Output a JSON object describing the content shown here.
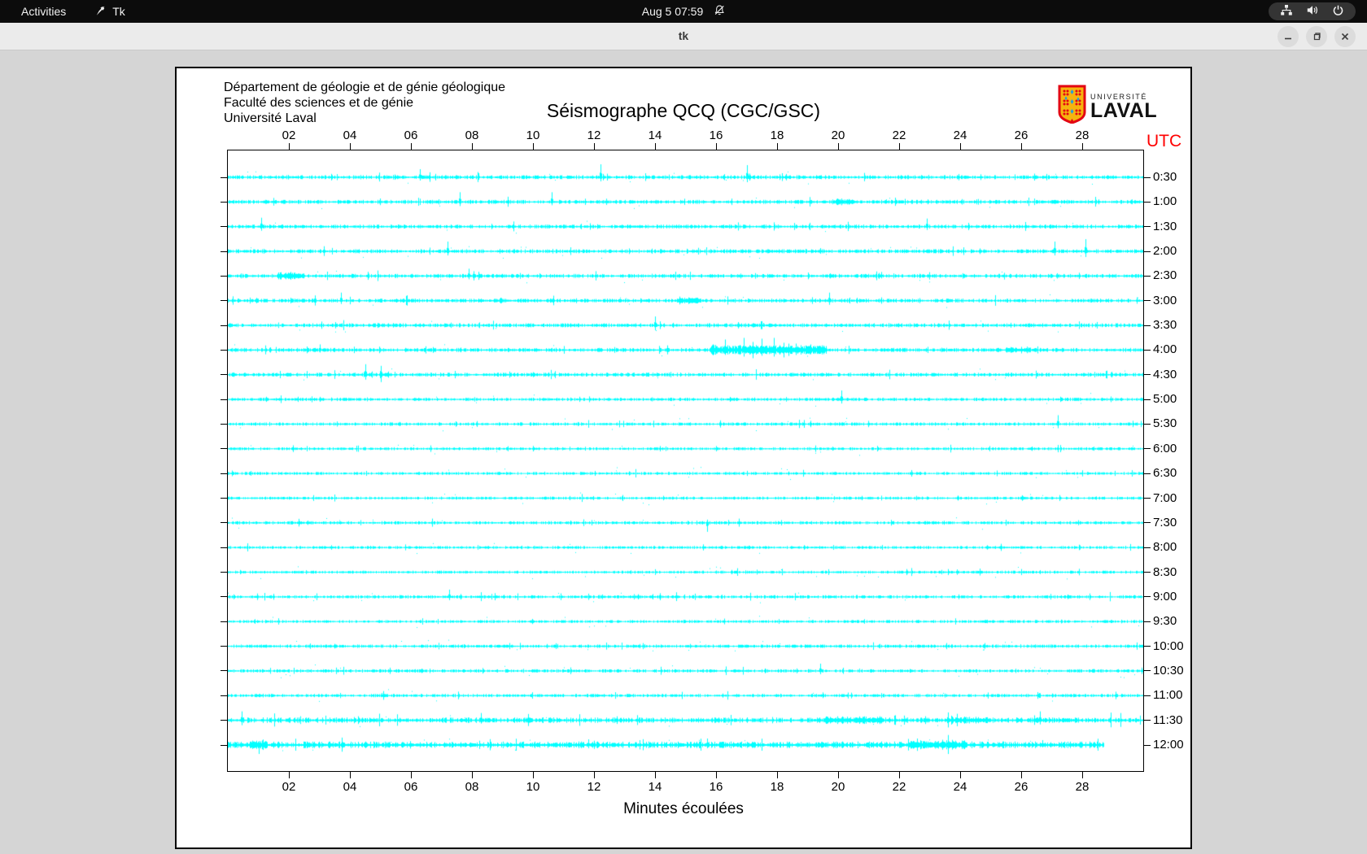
{
  "desktop": {
    "top_bar": {
      "activities_label": "Activities",
      "app_name": "Tk",
      "clock": "Aug 5 07:59",
      "icon_names": [
        "tk-app-icon",
        "notifications-disabled-icon",
        "network-wired-icon",
        "volume-icon",
        "power-icon"
      ]
    },
    "window": {
      "title": "tk",
      "controls": [
        "minimize",
        "maximize",
        "close"
      ]
    }
  },
  "seismograph": {
    "header_lines": [
      "Département de géologie et de génie géologique",
      "Faculté des sciences et de génie",
      "Université Laval"
    ],
    "title": "Séismographe QCQ (CGC/GSC)",
    "utc_label": "UTC",
    "x_axis_label": "Minutes écoulées",
    "logo": {
      "line1": "UNIVERSITÉ",
      "line2": "LAVAL"
    },
    "colors": {
      "trace": "#00ffff",
      "utc_label": "#ff0000",
      "logo_gold": "#f6b40e",
      "logo_red": "#e30513",
      "logo_blue": "#2b9cd8"
    },
    "chart_data": {
      "type": "line",
      "description": "24 half-hour seismogram sweeps, 30 minutes per line",
      "x_range_minutes": [
        0,
        30
      ],
      "x_tick_minutes": [
        2,
        4,
        6,
        8,
        10,
        12,
        14,
        16,
        18,
        20,
        22,
        24,
        26,
        28
      ],
      "x_tick_labels": [
        "02",
        "04",
        "06",
        "08",
        "10",
        "12",
        "14",
        "16",
        "18",
        "20",
        "22",
        "24",
        "26",
        "28"
      ],
      "rows": [
        {
          "label": "0:30",
          "base": 1.2,
          "end": 30,
          "spikes": [
            [
              6.3,
              10,
              4
            ],
            [
              8.2,
              5,
              3
            ],
            [
              12.2,
              16,
              5
            ],
            [
              17.0,
              15,
              6
            ]
          ],
          "bands": []
        },
        {
          "label": "1:00",
          "base": 1.2,
          "end": 30,
          "spikes": [
            [
              7.6,
              12,
              5
            ],
            [
              10.6,
              12,
              4
            ],
            [
              20.1,
              4,
              4
            ]
          ],
          "bands": [
            [
              19.8,
              20.5,
              1.5
            ]
          ]
        },
        {
          "label": "1:30",
          "base": 1.2,
          "end": 30,
          "spikes": [
            [
              1.1,
              11,
              5
            ],
            [
              22.9,
              10,
              4
            ]
          ],
          "bands": []
        },
        {
          "label": "2:00",
          "base": 1.2,
          "end": 30,
          "spikes": [
            [
              7.2,
              12,
              5
            ],
            [
              19.4,
              4,
              3
            ],
            [
              27.1,
              12,
              5
            ],
            [
              28.1,
              15,
              7
            ]
          ],
          "bands": []
        },
        {
          "label": "2:30",
          "base": 1.2,
          "end": 30,
          "spikes": [
            [
              1.9,
              4,
              4
            ],
            [
              2.3,
              3,
              3
            ],
            [
              7.9,
              9,
              4
            ],
            [
              16.8,
              3,
              3
            ],
            [
              21.4,
              5,
              3
            ]
          ],
          "bands": [
            [
              1.6,
              2.5,
              2
            ]
          ]
        },
        {
          "label": "3:00",
          "base": 1.2,
          "end": 30,
          "spikes": [
            [
              3.7,
              10,
              4
            ],
            [
              11.4,
              3,
              3
            ],
            [
              15.1,
              4,
              4
            ],
            [
              19.7,
              10,
              5
            ]
          ],
          "bands": [
            [
              14.8,
              15.4,
              2
            ]
          ]
        },
        {
          "label": "3:30",
          "base": 1.2,
          "end": 30,
          "spikes": [
            [
              4.9,
              3,
              3
            ],
            [
              14.0,
              11,
              6
            ]
          ],
          "bands": []
        },
        {
          "label": "4:00",
          "base": 1.2,
          "end": 30,
          "spikes": [
            [
              3.0,
              7,
              3
            ],
            [
              16.3,
              13,
              6
            ],
            [
              16.9,
              15,
              8
            ],
            [
              17.2,
              10,
              10
            ],
            [
              17.5,
              14,
              7
            ],
            [
              17.9,
              15,
              8
            ],
            [
              18.2,
              9,
              9
            ],
            [
              18.6,
              8,
              6
            ],
            [
              19.1,
              7,
              5
            ],
            [
              26.0,
              4,
              4
            ]
          ],
          "bands": [
            [
              15.8,
              19.6,
              3.5
            ],
            [
              25.5,
              26.3,
              1.5
            ]
          ]
        },
        {
          "label": "4:30",
          "base": 1.2,
          "end": 30,
          "spikes": [
            [
              4.5,
              13,
              6
            ],
            [
              5.0,
              11,
              9
            ]
          ],
          "bands": []
        },
        {
          "label": "5:00",
          "base": 1.0,
          "end": 30,
          "spikes": [
            [
              20.1,
              11,
              5
            ]
          ],
          "bands": []
        },
        {
          "label": "5:30",
          "base": 1.0,
          "end": 30,
          "spikes": [
            [
              27.2,
              11,
              5
            ]
          ],
          "bands": []
        },
        {
          "label": "6:00",
          "base": 0.9,
          "end": 30,
          "spikes": [],
          "bands": []
        },
        {
          "label": "6:30",
          "base": 0.9,
          "end": 30,
          "spikes": [],
          "bands": []
        },
        {
          "label": "7:00",
          "base": 0.9,
          "end": 30,
          "spikes": [],
          "bands": []
        },
        {
          "label": "7:30",
          "base": 1.0,
          "end": 30,
          "spikes": [
            [
              15.7,
              4,
              11
            ]
          ],
          "bands": []
        },
        {
          "label": "8:00",
          "base": 0.9,
          "end": 30,
          "spikes": [],
          "bands": []
        },
        {
          "label": "8:30",
          "base": 0.9,
          "end": 30,
          "spikes": [],
          "bands": []
        },
        {
          "label": "9:00",
          "base": 1.0,
          "end": 30,
          "spikes": [
            [
              7.25,
              9,
              4
            ]
          ],
          "bands": []
        },
        {
          "label": "9:30",
          "base": 0.9,
          "end": 30,
          "spikes": [],
          "bands": []
        },
        {
          "label": "10:00",
          "base": 1.0,
          "end": 30,
          "spikes": [
            [
              24.8,
              4,
              3
            ]
          ],
          "bands": []
        },
        {
          "label": "10:30",
          "base": 1.0,
          "end": 30,
          "spikes": [
            [
              19.4,
              9,
              4
            ]
          ],
          "bands": []
        },
        {
          "label": "11:00",
          "base": 1.0,
          "end": 30,
          "spikes": [
            [
              19.5,
              4,
              3
            ]
          ],
          "bands": []
        },
        {
          "label": "11:30",
          "base": 1.6,
          "end": 30,
          "spikes": [
            [
              0.45,
              11,
              6
            ],
            [
              8.3,
              9,
              4
            ],
            [
              26.6,
              11,
              5
            ]
          ],
          "bands": [
            [
              19.5,
              21.5,
              1.5
            ],
            [
              23.5,
              25.0,
              1.0
            ]
          ]
        },
        {
          "label": "12:00",
          "base": 2.0,
          "end": 28.7,
          "spikes": [
            [
              1.0,
              5,
              11
            ],
            [
              11.8,
              7,
              4
            ],
            [
              15.7,
              8,
              4
            ],
            [
              26.7,
              6,
              3
            ]
          ],
          "bands": [
            [
              0.7,
              1.3,
              2.5
            ],
            [
              22.3,
              24.2,
              2
            ]
          ]
        }
      ]
    }
  }
}
